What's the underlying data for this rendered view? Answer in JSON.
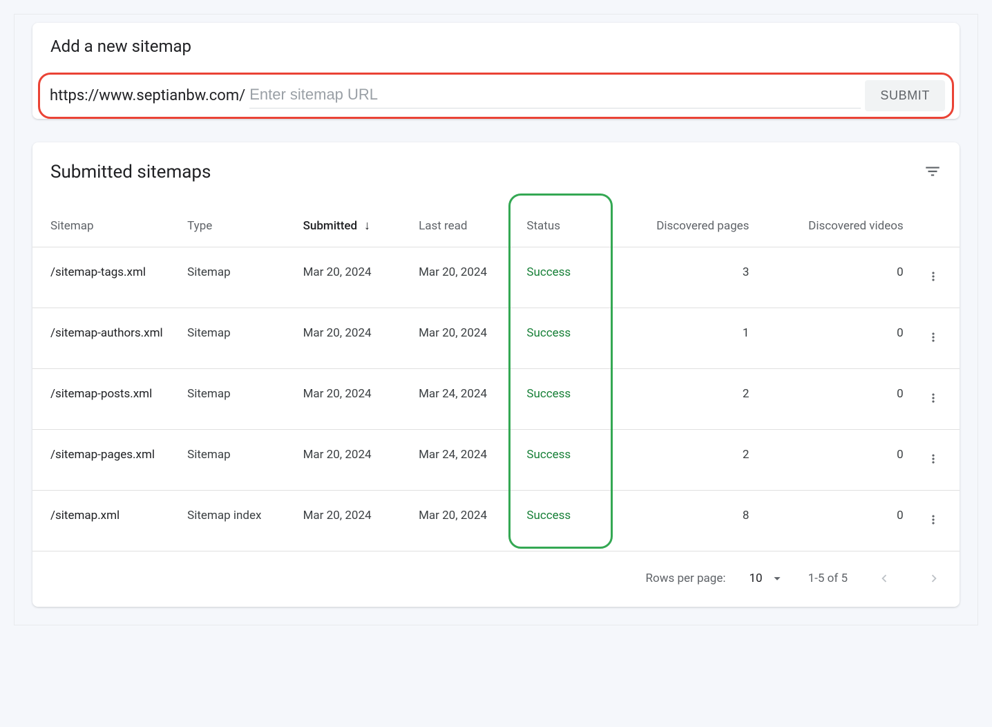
{
  "add": {
    "title": "Add a new sitemap",
    "prefix": "https://www.septianbw.com/",
    "placeholder": "Enter sitemap URL",
    "submit": "SUBMIT"
  },
  "list": {
    "title": "Submitted sitemaps",
    "columns": {
      "sitemap": "Sitemap",
      "type": "Type",
      "submitted": "Submitted",
      "last_read": "Last read",
      "status": "Status",
      "pages": "Discovered pages",
      "videos": "Discovered videos"
    },
    "sort_indicator": "↓",
    "rows": [
      {
        "sitemap": "/sitemap-tags.xml",
        "type": "Sitemap",
        "submitted": "Mar 20, 2024",
        "last_read": "Mar 20, 2024",
        "status": "Success",
        "pages": "3",
        "videos": "0"
      },
      {
        "sitemap": "/sitemap-authors.xml",
        "type": "Sitemap",
        "submitted": "Mar 20, 2024",
        "last_read": "Mar 20, 2024",
        "status": "Success",
        "pages": "1",
        "videos": "0"
      },
      {
        "sitemap": "/sitemap-posts.xml",
        "type": "Sitemap",
        "submitted": "Mar 20, 2024",
        "last_read": "Mar 24, 2024",
        "status": "Success",
        "pages": "2",
        "videos": "0"
      },
      {
        "sitemap": "/sitemap-pages.xml",
        "type": "Sitemap",
        "submitted": "Mar 20, 2024",
        "last_read": "Mar 24, 2024",
        "status": "Success",
        "pages": "2",
        "videos": "0"
      },
      {
        "sitemap": "/sitemap.xml",
        "type": "Sitemap index",
        "submitted": "Mar 20, 2024",
        "last_read": "Mar 20, 2024",
        "status": "Success",
        "pages": "8",
        "videos": "0"
      }
    ]
  },
  "pager": {
    "rows_label": "Rows per page:",
    "rows_value": "10",
    "range": "1-5 of 5"
  }
}
